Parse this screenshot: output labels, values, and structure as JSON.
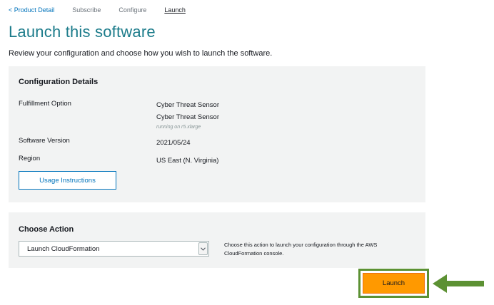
{
  "breadcrumb": {
    "product_detail": "< Product Detail",
    "subscribe": "Subscribe",
    "configure": "Configure",
    "launch": "Launch"
  },
  "page": {
    "title": "Launch this software",
    "subtitle": "Review your configuration and choose how you wish to launch the software."
  },
  "config": {
    "heading": "Configuration Details",
    "fulfillment_label": "Fulfillment Option",
    "fulfillment_value_1": "Cyber Threat Sensor",
    "fulfillment_value_2": "Cyber Threat Sensor",
    "fulfillment_note": "running on r5.xlarge",
    "version_label": "Software Version",
    "version_value": "2021/05/24",
    "region_label": "Region",
    "region_value": "US East (N. Virginia)",
    "usage_button": "Usage Instructions"
  },
  "action": {
    "heading": "Choose Action",
    "select_value": "Launch CloudFormation",
    "help_text": "Choose this action to launch your configuration through the AWS CloudFormation console."
  },
  "launch_button": "Launch",
  "colors": {
    "title": "#1b7b8a",
    "link": "#0073bb",
    "panel": "#f2f3f3",
    "primary_button": "#ff9900",
    "highlight": "#5c9133"
  },
  "icons": {
    "select_caret": "chevron-down-icon",
    "pointer": "arrow-left-icon"
  }
}
